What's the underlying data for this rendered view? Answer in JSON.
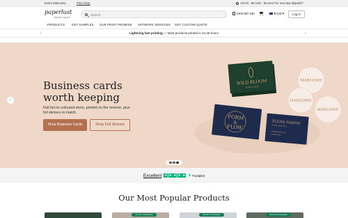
{
  "topbar": {
    "tabs": [
      {
        "label": "Event Stationery",
        "active": false
      },
      {
        "label": "Print Shop",
        "active": true
      }
    ],
    "dispatch_text": "19 hrs : 58 mins : 59 secs For next day dispatch*"
  },
  "header": {
    "logo_main": "paperlust",
    "logo_sub": "PRINT SHOP",
    "search_placeholder": "Search",
    "phone": "1300 997 636",
    "currency": "$AUD",
    "login_label": "Log In"
  },
  "nav": {
    "items": [
      "PRODUCTS",
      "GET SAMPLES",
      "OUR PRINT PROMISE",
      "ARTWORK SERVICES",
      "GET CUSTOM QUOTE"
    ]
  },
  "promo": {
    "bold": "Lightning fast printing",
    "rest": " — Most products printed in 24-48 hours",
    "prev": "‹",
    "next": "›"
  },
  "hero": {
    "title_line1": "Business cards",
    "title_line2": "worth keeping",
    "desc": "Flat foil on coloured stock, printed on the reverse, plus foil stickers to match.",
    "primary_cta": "Shop Business Cards",
    "secondary_cta": "Shop Foil Stickers",
    "prev": "‹",
    "card_texts": {
      "green_card_1": "WILD BLOOM",
      "green_card_2": "FLORAL STUDIO",
      "navy_card_1_1": "FORM",
      "navy_card_1_2": "&",
      "navy_card_1_3": "FLOW",
      "navy_card_2_name": "ELENA MARSH",
      "navy_card_2_title": "STUDIO DIRECTOR",
      "navy_card_2_email": "hello@formflow.com",
      "navy_card_2_phone": "02 9080 4400",
      "sticker": "MARLOWE"
    },
    "slides_total": 3,
    "slide_active": 3
  },
  "trust": {
    "rating_word": "Excellent",
    "stars": [
      "★",
      "★",
      "★",
      "★",
      "★"
    ],
    "brand": "Trustpilot"
  },
  "popular": {
    "title": "Our Most Popular Products",
    "badges": [
      "",
      "24 Hour Production",
      "24 Hour Production",
      "24 Hour Production"
    ]
  },
  "colors": {
    "hero_bg": "#efd8c7",
    "cta": "#b3714f",
    "trustpilot_green": "#00b67a",
    "card_green": "#20402f",
    "card_navy": "#1e2b4d",
    "foil_gold": "#c9a06a"
  }
}
